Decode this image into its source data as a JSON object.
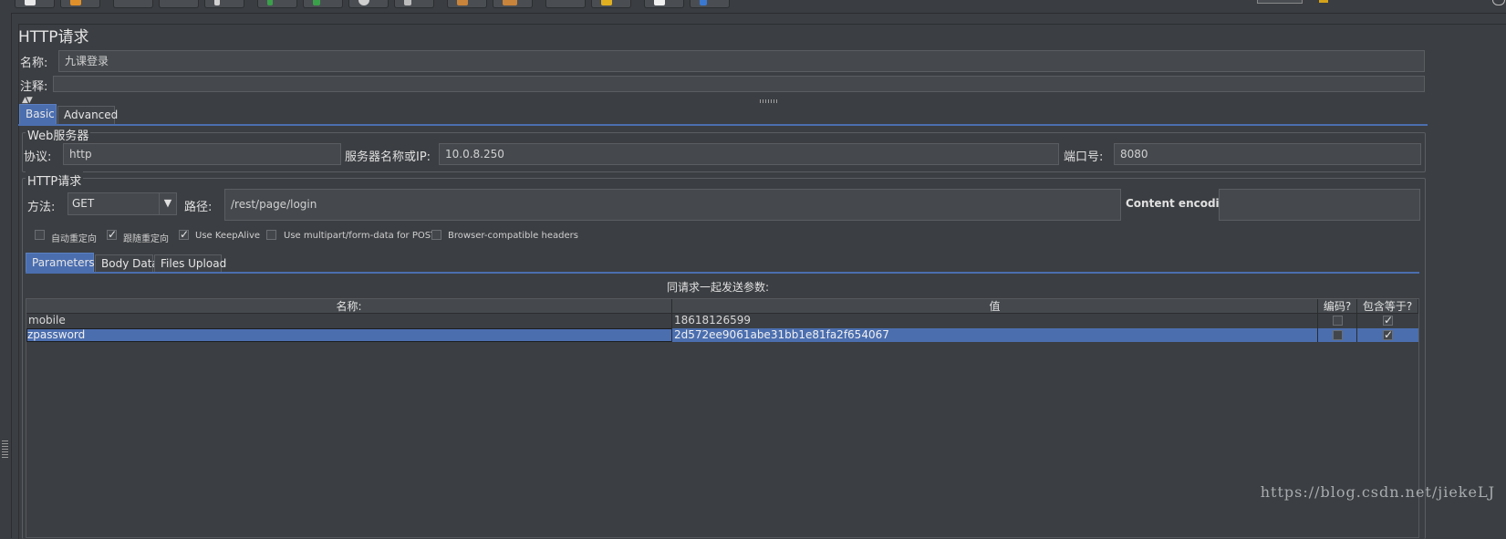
{
  "panel": {
    "title": "HTTP请求"
  },
  "name_row": {
    "label": "名称:",
    "value": "九课登录"
  },
  "comment_row": {
    "label": "注释:",
    "value": ""
  },
  "tabs_main": [
    {
      "label": "Basic"
    },
    {
      "label": "Advanced"
    }
  ],
  "web_server": {
    "title": "Web服务器",
    "protocol_label": "协议:",
    "protocol_value": "http",
    "server_label": "服务器名称或IP:",
    "server_value": "10.0.8.250",
    "port_label": "端口号:",
    "port_value": "8080"
  },
  "http_request": {
    "title": "HTTP请求",
    "method_label": "方法:",
    "method_value": "GET",
    "path_label": "路径:",
    "path_value": "/rest/page/login",
    "encoding_label": "Content encoding:",
    "encoding_value": ""
  },
  "options": [
    {
      "label": "自动重定向",
      "checked": false
    },
    {
      "label": "跟随重定向",
      "checked": true
    },
    {
      "label": "Use KeepAlive",
      "checked": true
    },
    {
      "label": "Use multipart/form-data for POST",
      "checked": false
    },
    {
      "label": "Browser-compatible headers",
      "checked": false
    }
  ],
  "tabs_params": [
    {
      "label": "Parameters"
    },
    {
      "label": "Body Data"
    },
    {
      "label": "Files Upload"
    }
  ],
  "params": {
    "caption": "同请求一起发送参数:",
    "columns": [
      "名称:",
      "值",
      "编码?",
      "包含等于?"
    ],
    "rows": [
      {
        "name": "mobile",
        "value": "18618126599",
        "encode": false,
        "include_equals": true
      },
      {
        "name": "zpassword",
        "value": "2d572ee9061abe31bb1e81fa2f654067",
        "encode": false,
        "include_equals": true
      }
    ]
  },
  "watermark": "https://blog.csdn.net/jiekeLJ",
  "colors": {
    "accent": "#4b6eaf",
    "background": "#3b3e42",
    "field": "#45494d"
  }
}
